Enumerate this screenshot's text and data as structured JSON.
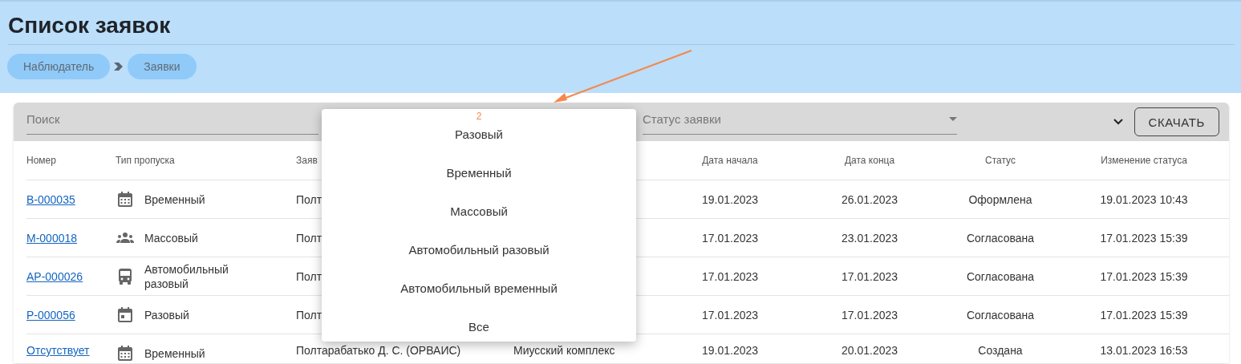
{
  "page": {
    "title": "Список заявок",
    "breadcrumbs": [
      {
        "label": "Наблюдатель"
      },
      {
        "label": "Заявки"
      }
    ]
  },
  "filters": {
    "search": {
      "placeholder": "Поиск"
    },
    "status": {
      "placeholder": "Статус заявки"
    },
    "download_button": "СКАЧАТЬ"
  },
  "table": {
    "columns": [
      "Номер",
      "Тип пропуска",
      "Заяв",
      "Дата начала",
      "Дата конца",
      "Статус",
      "Изменение статуса"
    ],
    "rows": [
      {
        "number": "В-000035",
        "pass_type": {
          "kind": "calendar-grid",
          "label": "Временный"
        },
        "applicant": "Полт",
        "start": "19.01.2023",
        "end": "26.01.2023",
        "status": "Оформлена",
        "changed": "19.01.2023 10:43"
      },
      {
        "number": "М-000018",
        "pass_type": {
          "kind": "group",
          "label": "Массовый"
        },
        "applicant": "Полт",
        "start": "17.01.2023",
        "end": "23.01.2023",
        "status": "Согласована",
        "changed": "17.01.2023 15:39"
      },
      {
        "number": "АР-000026",
        "pass_type": {
          "kind": "bus",
          "label": "Автомобильный разовый"
        },
        "applicant": "Полт",
        "start": "17.01.2023",
        "end": "17.01.2023",
        "status": "Согласована",
        "changed": "17.01.2023 15:39"
      },
      {
        "number": "Р-000056",
        "pass_type": {
          "kind": "calendar-day",
          "label": "Разовый"
        },
        "applicant": "Полт",
        "start": "17.01.2023",
        "end": "17.01.2023",
        "status": "Согласована",
        "changed": "17.01.2023 15:39"
      },
      {
        "number": "Отсутствует",
        "pass_type": {
          "kind": "calendar-grid",
          "label": "Временный"
        },
        "applicant": "Полтарабатько Д. С. (ОРВАИС)",
        "location": "Миусский комплекс",
        "start": "19.01.2023",
        "end": "20.01.2023",
        "status": "Создана",
        "changed": "13.01.2023 16:53"
      }
    ]
  },
  "menu": {
    "callout": "2",
    "items": [
      {
        "label": "Разовый"
      },
      {
        "label": "Временный"
      },
      {
        "label": "Массовый"
      },
      {
        "label": "Автомобильный разовый"
      },
      {
        "label": "Автомобильный временный"
      },
      {
        "label": "Все"
      }
    ]
  }
}
